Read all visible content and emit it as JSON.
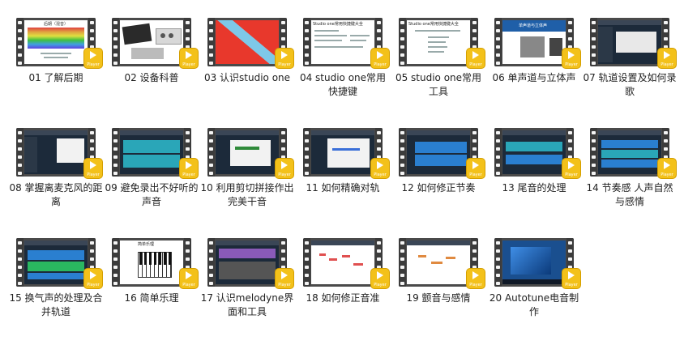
{
  "lessons": [
    {
      "label": "01 了解后期",
      "screen_title": "后期（混音）"
    },
    {
      "label": "02 设备科普"
    },
    {
      "label": "03 认识studio one"
    },
    {
      "label": "04 studio one常用快捷键",
      "screen_title": "Studio one常用快捷键大全"
    },
    {
      "label": "05 studio one常用工具",
      "screen_title": "Studio one常用快捷键大全"
    },
    {
      "label": "06 单声道与立体声",
      "screen_title": "单声道与立体声"
    },
    {
      "label": "07 轨道设置及如何录歌"
    },
    {
      "label": "08 掌握离麦克风的距离"
    },
    {
      "label": "09 避免录出不好听的声音"
    },
    {
      "label": "10 利用剪切拼接作出完美干音"
    },
    {
      "label": "11 如何精确对轨"
    },
    {
      "label": "12 如何修正节奏"
    },
    {
      "label": "13 尾音的处理"
    },
    {
      "label": "14 节奏感 人声自然与感情"
    },
    {
      "label": "15 换气声的处理及合并轨道"
    },
    {
      "label": "16 简单乐理",
      "screen_title": "简单乐理"
    },
    {
      "label": "17 认识melodyne界面和工具"
    },
    {
      "label": "18 如何修正音准"
    },
    {
      "label": "19 颤音与感情"
    },
    {
      "label": "20 Autotune电音制作"
    }
  ],
  "badge_text": "Player",
  "colors": {
    "badge": "#f3c11a",
    "film": "#3c3c3c",
    "daw_bg": "#1c2a3a"
  }
}
